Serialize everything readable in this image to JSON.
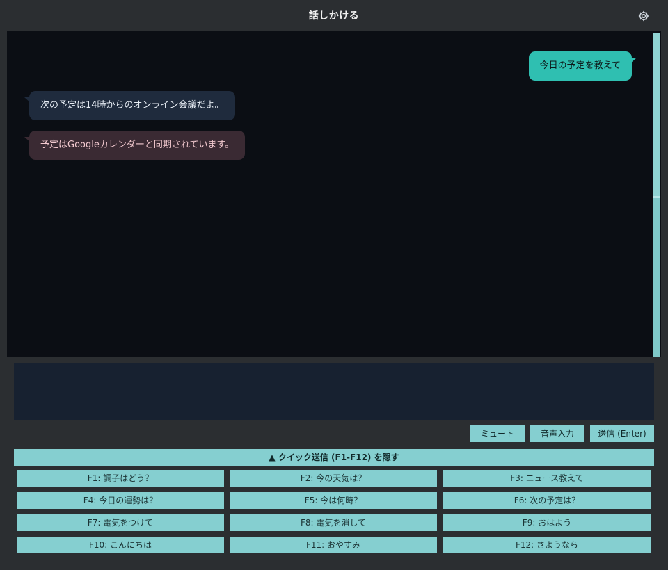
{
  "window": {
    "title": "話しかける"
  },
  "icons": {
    "settings": "gear-icon"
  },
  "colors": {
    "accent": "#85cfd0",
    "user_bubble": "#2fbfb1",
    "bot_bubble": "#1f2b3d",
    "system_bubble": "#3a2a33",
    "chat_bg": "#0b0e14"
  },
  "chat": {
    "messages": [
      {
        "role": "user",
        "text": "今日の予定を教えて"
      },
      {
        "role": "assistant",
        "text": "次の予定は14時からのオンライン会議だよ。"
      },
      {
        "role": "system",
        "text": "予定はGoogleカレンダーと同期されています。"
      }
    ]
  },
  "input": {
    "value": "",
    "placeholder": ""
  },
  "controls": {
    "mute": "ミュート",
    "voice_input": "音声入力",
    "send": "送信 (Enter)"
  },
  "quick": {
    "toggle_label": "▲ クイック送信 (F1-F12) を隠す",
    "buttons": [
      "F1: 調子はどう？",
      "F2: 今の天気は？",
      "F3: ニュース教えて",
      "F4: 今日の運勢は？",
      "F5: 今は何時？",
      "F6: 次の予定は？",
      "F7: 電気をつけて",
      "F8: 電気を消して",
      "F9: おはよう",
      "F10: こんにちは",
      "F11: おやすみ",
      "F12: さようなら"
    ]
  }
}
